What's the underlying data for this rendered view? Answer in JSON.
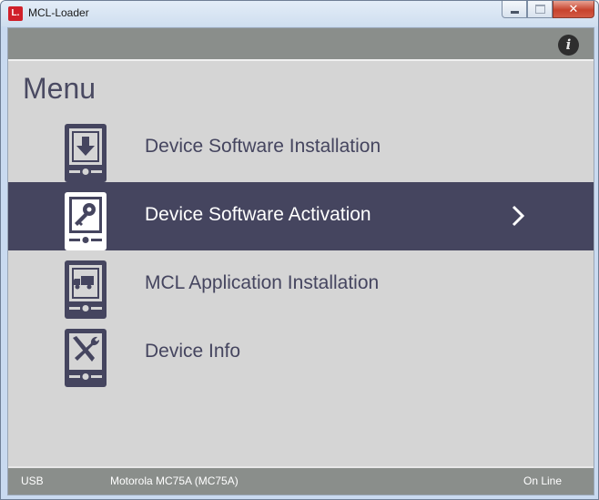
{
  "window": {
    "title": "MCL-Loader",
    "app_icon_letter": "L."
  },
  "header": {
    "info_icon": "info-icon"
  },
  "menu": {
    "title": "Menu",
    "items": [
      {
        "label": "Device Software Installation",
        "icon": "download-device-icon",
        "selected": false
      },
      {
        "label": "Device Software Activation",
        "icon": "key-device-icon",
        "selected": true
      },
      {
        "label": "MCL Application Installation",
        "icon": "truck-device-icon",
        "selected": false
      },
      {
        "label": "Device Info",
        "icon": "tools-device-icon",
        "selected": false
      }
    ]
  },
  "status": {
    "connection": "USB",
    "device": "Motorola MC75A (MC75A)",
    "state": "On Line"
  },
  "colors": {
    "selected_row": "#45455f",
    "icon_fill": "#45455f",
    "bar": "#8a8e8b",
    "background": "#d5d5d5"
  }
}
